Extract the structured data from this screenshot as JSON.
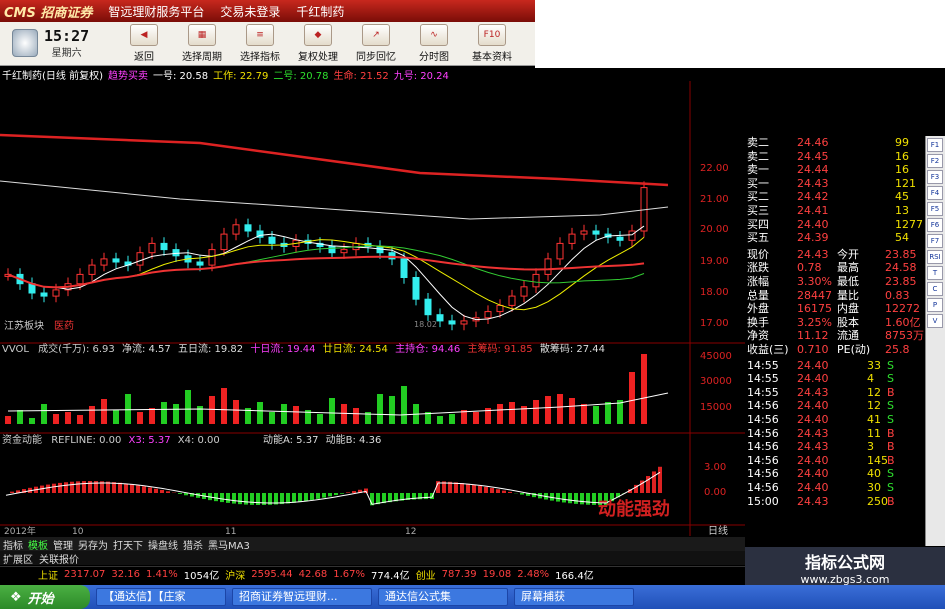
{
  "titlebar": {
    "logo": "CMS 招商证券",
    "items": [
      "智远理财服务平台",
      "交易未登录",
      "千红制药"
    ]
  },
  "clock": {
    "time": "15:27",
    "weekday": "星期六"
  },
  "toolbar": [
    {
      "label": "返回",
      "icon": "back-arrow-icon"
    },
    {
      "label": "选择周期",
      "icon": "period-icon"
    },
    {
      "label": "选择指标",
      "icon": "indicator-icon"
    },
    {
      "label": "复权处理",
      "icon": "adjust-icon"
    },
    {
      "label": "同步回忆",
      "icon": "sync-icon"
    },
    {
      "label": "分时图",
      "icon": "minute-chart-icon"
    },
    {
      "label": "基本资料",
      "icon": "f10-icon",
      "glyph": "F10"
    }
  ],
  "chart_info": {
    "stock": "千红制药(日线 前复权)",
    "ind": "趋势买卖",
    "v1": "一号: 20.58",
    "v2": "工作: 22.79",
    "v3": "二号: 20.78",
    "v4": "生命: 21.52",
    "v5": "九号: 20.24"
  },
  "price_axis": [
    "22.00",
    "21.00",
    "20.00",
    "19.00",
    "18.00",
    "17.00"
  ],
  "price_labels": {
    "sector": "江苏板块",
    "industry": "医药",
    "low_mark": "18.02"
  },
  "vol_info": {
    "name": "VVOL",
    "a": "成交(千万): 6.93",
    "b": "净流: 4.57",
    "c": "五日流: 19.82",
    "d": "十日流: 19.44",
    "e": "廿日流: 24.54",
    "f": "主持仓: 94.46",
    "g": "主筹码: 91.85",
    "h": "散筹码: 27.44"
  },
  "vol_axis": [
    "45000",
    "30000",
    "15000"
  ],
  "fund_info": {
    "name": "资金动能",
    "a": "REFLINE: 0.00",
    "b": "X3: 5.37",
    "c": "X4: 0.00",
    "d": "动能A: 5.37",
    "e": "动能B: 4.36"
  },
  "fund_axis": [
    "3.00",
    "0.00"
  ],
  "fund_stamp": "动能强劲",
  "date_axis": [
    "2012年",
    "10",
    "11",
    "12"
  ],
  "period_btn": "日线",
  "nav_tabs": [
    "指标",
    "模板",
    "管理",
    "另存为",
    "打天下",
    "操盘线",
    "猎杀",
    "黑马MA3"
  ],
  "sub_tabs": [
    "扩展区",
    "关联报价"
  ],
  "orderbook": [
    {
      "k": "卖二",
      "p": "24.46",
      "v": "99"
    },
    {
      "k": "卖二",
      "p": "24.45",
      "v": "16"
    },
    {
      "k": "卖一",
      "p": "24.44",
      "v": "16"
    },
    {
      "k": "买一",
      "p": "24.43",
      "v": "121"
    },
    {
      "k": "买二",
      "p": "24.42",
      "v": "45"
    },
    {
      "k": "买三",
      "p": "24.41",
      "v": "13"
    },
    {
      "k": "买四",
      "p": "24.40",
      "v": "1277"
    },
    {
      "k": "买五",
      "p": "24.39",
      "v": "54"
    }
  ],
  "stats": [
    {
      "a": "现价",
      "b": "24.43",
      "c": "今开",
      "d": "23.85"
    },
    {
      "a": "涨跌",
      "b": "0.78",
      "c": "最高",
      "d": "24.58"
    },
    {
      "a": "涨幅",
      "b": "3.30%",
      "c": "最低",
      "d": "23.85"
    },
    {
      "a": "总量",
      "b": "28447",
      "c": "量比",
      "d": "0.83"
    },
    {
      "a": "外盘",
      "b": "16175",
      "c": "内盘",
      "d": "12272"
    },
    {
      "a": "换手",
      "b": "3.25%",
      "c": "股本",
      "d": "1.60亿"
    },
    {
      "a": "净资",
      "b": "11.12",
      "c": "流通",
      "d": "8753万"
    },
    {
      "a": "收益(三)",
      "b": "0.710",
      "c": "PE(动)",
      "d": "25.8"
    }
  ],
  "ticks": [
    {
      "t": "14:55",
      "p": "24.40",
      "v": "33",
      "s": "S"
    },
    {
      "t": "14:55",
      "p": "24.40",
      "v": "4",
      "s": "S"
    },
    {
      "t": "14:55",
      "p": "24.43",
      "v": "12",
      "s": "B"
    },
    {
      "t": "14:56",
      "p": "24.40",
      "v": "12",
      "s": "S"
    },
    {
      "t": "14:56",
      "p": "24.40",
      "v": "41",
      "s": "S"
    },
    {
      "t": "14:56",
      "p": "24.43",
      "v": "11",
      "s": "B"
    },
    {
      "t": "14:56",
      "p": "24.43",
      "v": "3",
      "s": "B"
    },
    {
      "t": "14:56",
      "p": "24.40",
      "v": "145",
      "s": "B"
    },
    {
      "t": "14:56",
      "p": "24.40",
      "v": "40",
      "s": "S"
    },
    {
      "t": "14:56",
      "p": "24.40",
      "v": "30",
      "s": "S"
    },
    {
      "t": "15:00",
      "p": "24.43",
      "v": "250",
      "s": "B"
    }
  ],
  "ticker": {
    "sh": "上证",
    "sh_v": "2317.07",
    "sh_c": "32.16",
    "sh_p": "1.41%",
    "sh_a": "1054亿",
    "sz": "沪深",
    "sz_v": "2595.44",
    "sz_c": "42.68",
    "sz_p": "1.67%",
    "sz_a": "774.4亿",
    "cy": "创业",
    "cy_v": "787.39",
    "cy_c": "19.08",
    "cy_p": "2.48%",
    "cy_a": "166.4亿"
  },
  "watermark": {
    "title": "指标公式网",
    "url": "www.zbgs3.com"
  },
  "taskbar": {
    "start": "开始",
    "tasks": [
      "【通达信】【庄家",
      "招商证券智远理财...",
      "通达信公式集",
      "屏幕捕获"
    ]
  },
  "sidebar_icons": [
    "F1",
    "F2",
    "F3",
    "F4",
    "F5",
    "F6",
    "F7",
    "RSI",
    "T",
    "C",
    "P",
    "V"
  ]
}
